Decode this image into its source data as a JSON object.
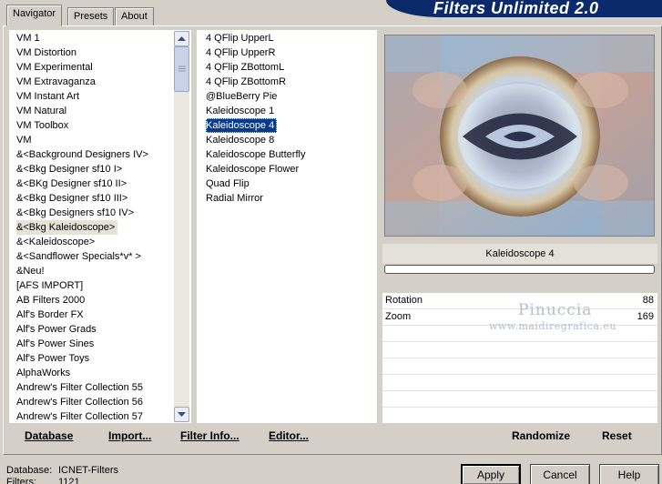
{
  "tabs": [
    "Navigator",
    "Presets",
    "About"
  ],
  "banner_title": "Filters Unlimited 2.0",
  "categories": [
    "VM 1",
    "VM Distortion",
    "VM Experimental",
    "VM Extravaganza",
    "VM Instant Art",
    "VM Natural",
    "VM Toolbox",
    "VM",
    "&<Background Designers IV>",
    "&<Bkg Designer sf10 I>",
    "&<BKg Designer sf10 II>",
    "&<Bkg Designer sf10 III>",
    "&<Bkg Designers sf10 IV>",
    "&<Bkg Kaleidoscope>",
    "&<Kaleidoscope>",
    "&<Sandflower Specials*v* >",
    "&Neu!",
    "[AFS IMPORT]",
    "AB Filters 2000",
    "Alf's Border FX",
    "Alf's Power Grads",
    "Alf's Power Sines",
    "Alf's Power Toys",
    "AlphaWorks",
    "Andrew's Filter Collection 55",
    "Andrew's Filter Collection 56",
    "Andrew's Filter Collection 57"
  ],
  "selected_category_index": 13,
  "filters": [
    "4 QFlip UpperL",
    "4 QFlip UpperR",
    "4 QFlip ZBottomL",
    "4 QFlip ZBottomR",
    "@BlueBerry Pie",
    "Kaleidoscope 1",
    "Kaleidoscope 4",
    "Kaleidoscope 8",
    "Kaleidoscope Butterfly",
    "Kaleidoscope Flower",
    "Quad Flip",
    "Radial Mirror"
  ],
  "selected_filter_index": 6,
  "toolbar": {
    "database": "Database",
    "import": "Import...",
    "filter_info": "Filter Info...",
    "editor": "Editor...",
    "randomize": "Randomize",
    "reset": "Reset"
  },
  "preview_caption": "Kaleidoscope 4",
  "progress_value": 0,
  "params": [
    {
      "label": "Rotation",
      "value": "88"
    },
    {
      "label": "Zoom",
      "value": "169"
    }
  ],
  "watermark": {
    "name": "Pinuccia",
    "url": "www.maidiregrafica.eu"
  },
  "status": {
    "database_label": "Database:",
    "database_value": "ICNET-Filters",
    "filters_label": "Filters:",
    "filters_value": "1121"
  },
  "buttons": {
    "apply": "Apply",
    "cancel": "Cancel",
    "help": "Help"
  },
  "colors": {
    "banner": "#0a2a6b",
    "selection": "#0a3a8c",
    "background": "#d4d0c8"
  }
}
